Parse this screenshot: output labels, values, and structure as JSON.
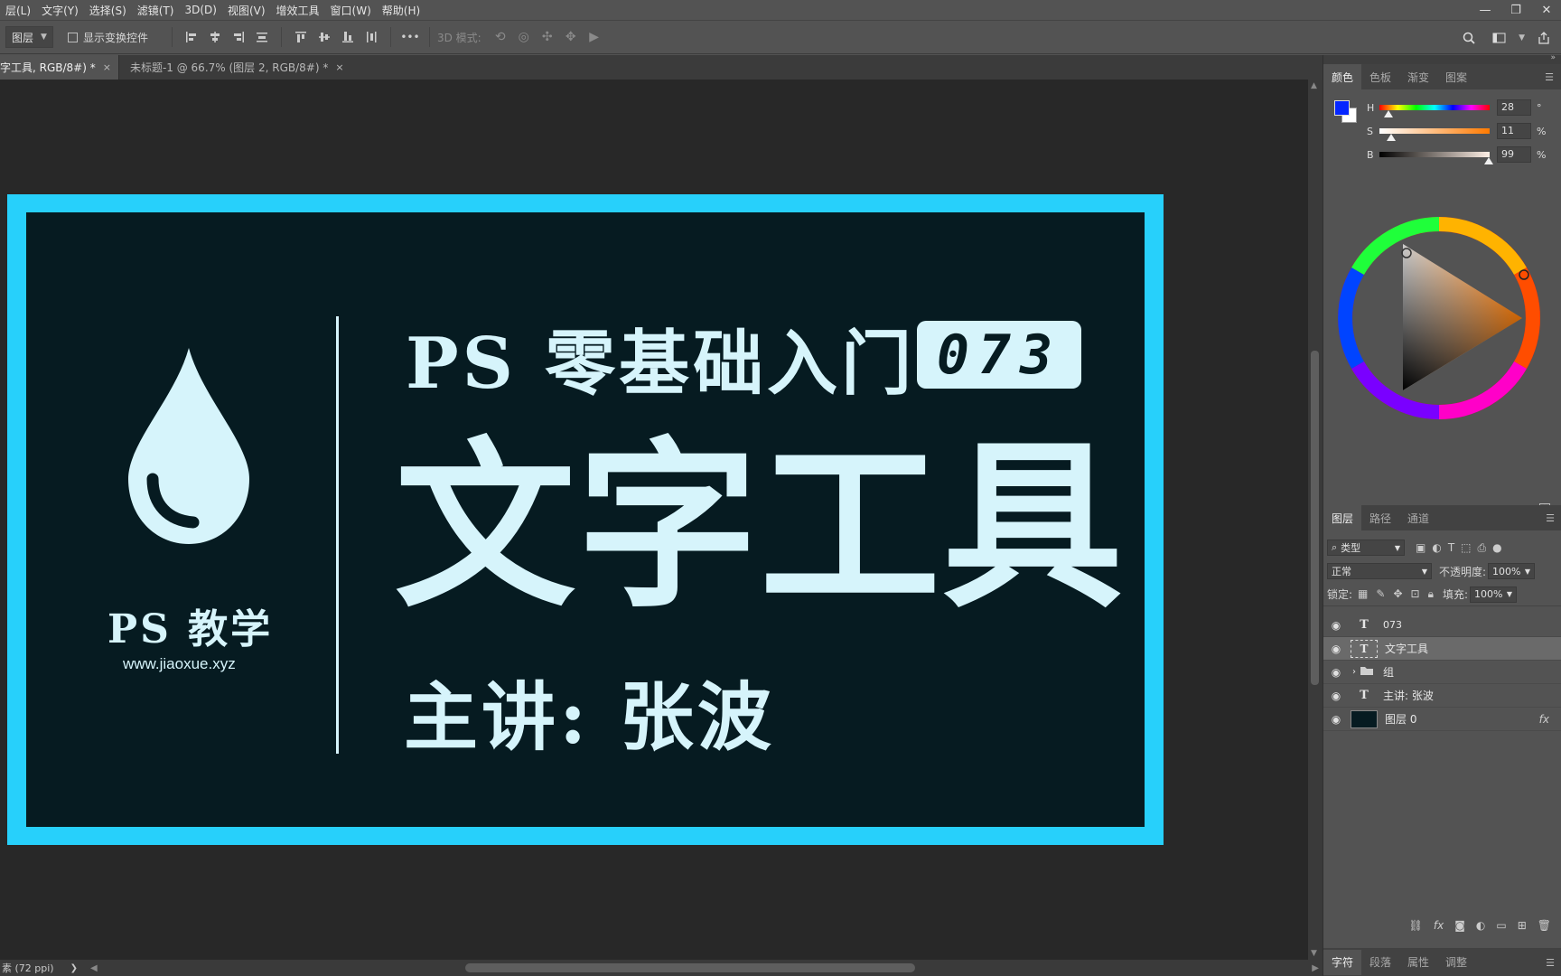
{
  "menubar": {
    "items": [
      "层(L)",
      "文字(Y)",
      "选择(S)",
      "滤镜(T)",
      "3D(D)",
      "视图(V)",
      "增效工具",
      "窗口(W)",
      "帮助(H)"
    ],
    "window_controls": [
      "—",
      "❐",
      "✕"
    ]
  },
  "options_bar": {
    "auto_select_value": "图层",
    "show_transform_label": "显示变换控件",
    "more_label": "•••",
    "mode_3d_label": "3D 模式:"
  },
  "doc_tabs": [
    {
      "label": "字工具, RGB/8#) *",
      "close": "×"
    },
    {
      "label": "未标题-1 @ 66.7% (图层 2, RGB/8#) *",
      "close": "×"
    }
  ],
  "status": {
    "resolution": "素 (72 ppi)",
    "arrow": "❯"
  },
  "artwork": {
    "logo_title": "PS 教学",
    "logo_url": "www.jiaoxue.xyz",
    "title_line": "PS 零基础入门",
    "episode": "073",
    "main_title": "文字工具",
    "presenter": "主讲: 张波",
    "colors": {
      "frame": "#27d0fb",
      "background": "#061b21",
      "text": "#d6f4fb"
    }
  },
  "color_panel": {
    "tabs": [
      "颜色",
      "色板",
      "渐变",
      "图案"
    ],
    "foreground": "#0526ff",
    "background": "#ffffff",
    "sliders": [
      {
        "label": "H",
        "value": "28",
        "unit": "°",
        "level": 0.08
      },
      {
        "label": "S",
        "value": "11",
        "unit": "%",
        "level": 0.11
      },
      {
        "label": "B",
        "value": "99",
        "unit": "%",
        "level": 0.99
      }
    ]
  },
  "layers_panel": {
    "tabs": [
      "图层",
      "路径",
      "通道"
    ],
    "filter_value": "类型",
    "blend_mode": "正常",
    "opacity_label": "不透明度:",
    "opacity_value": "100%",
    "lock_label": "锁定:",
    "fill_label": "填充:",
    "fill_value": "100%",
    "layers": [
      {
        "name": "073",
        "type": "text",
        "selected": false
      },
      {
        "name": "文字工具",
        "type": "text",
        "selected": true
      },
      {
        "name": "组",
        "type": "group",
        "selected": false
      },
      {
        "name": "主讲: 张波",
        "type": "text",
        "selected": false
      },
      {
        "name": "图层 0",
        "type": "image",
        "selected": false,
        "fx": "fx"
      }
    ]
  },
  "bottom_tabs": [
    "字符",
    "段落",
    "属性",
    "调整"
  ]
}
